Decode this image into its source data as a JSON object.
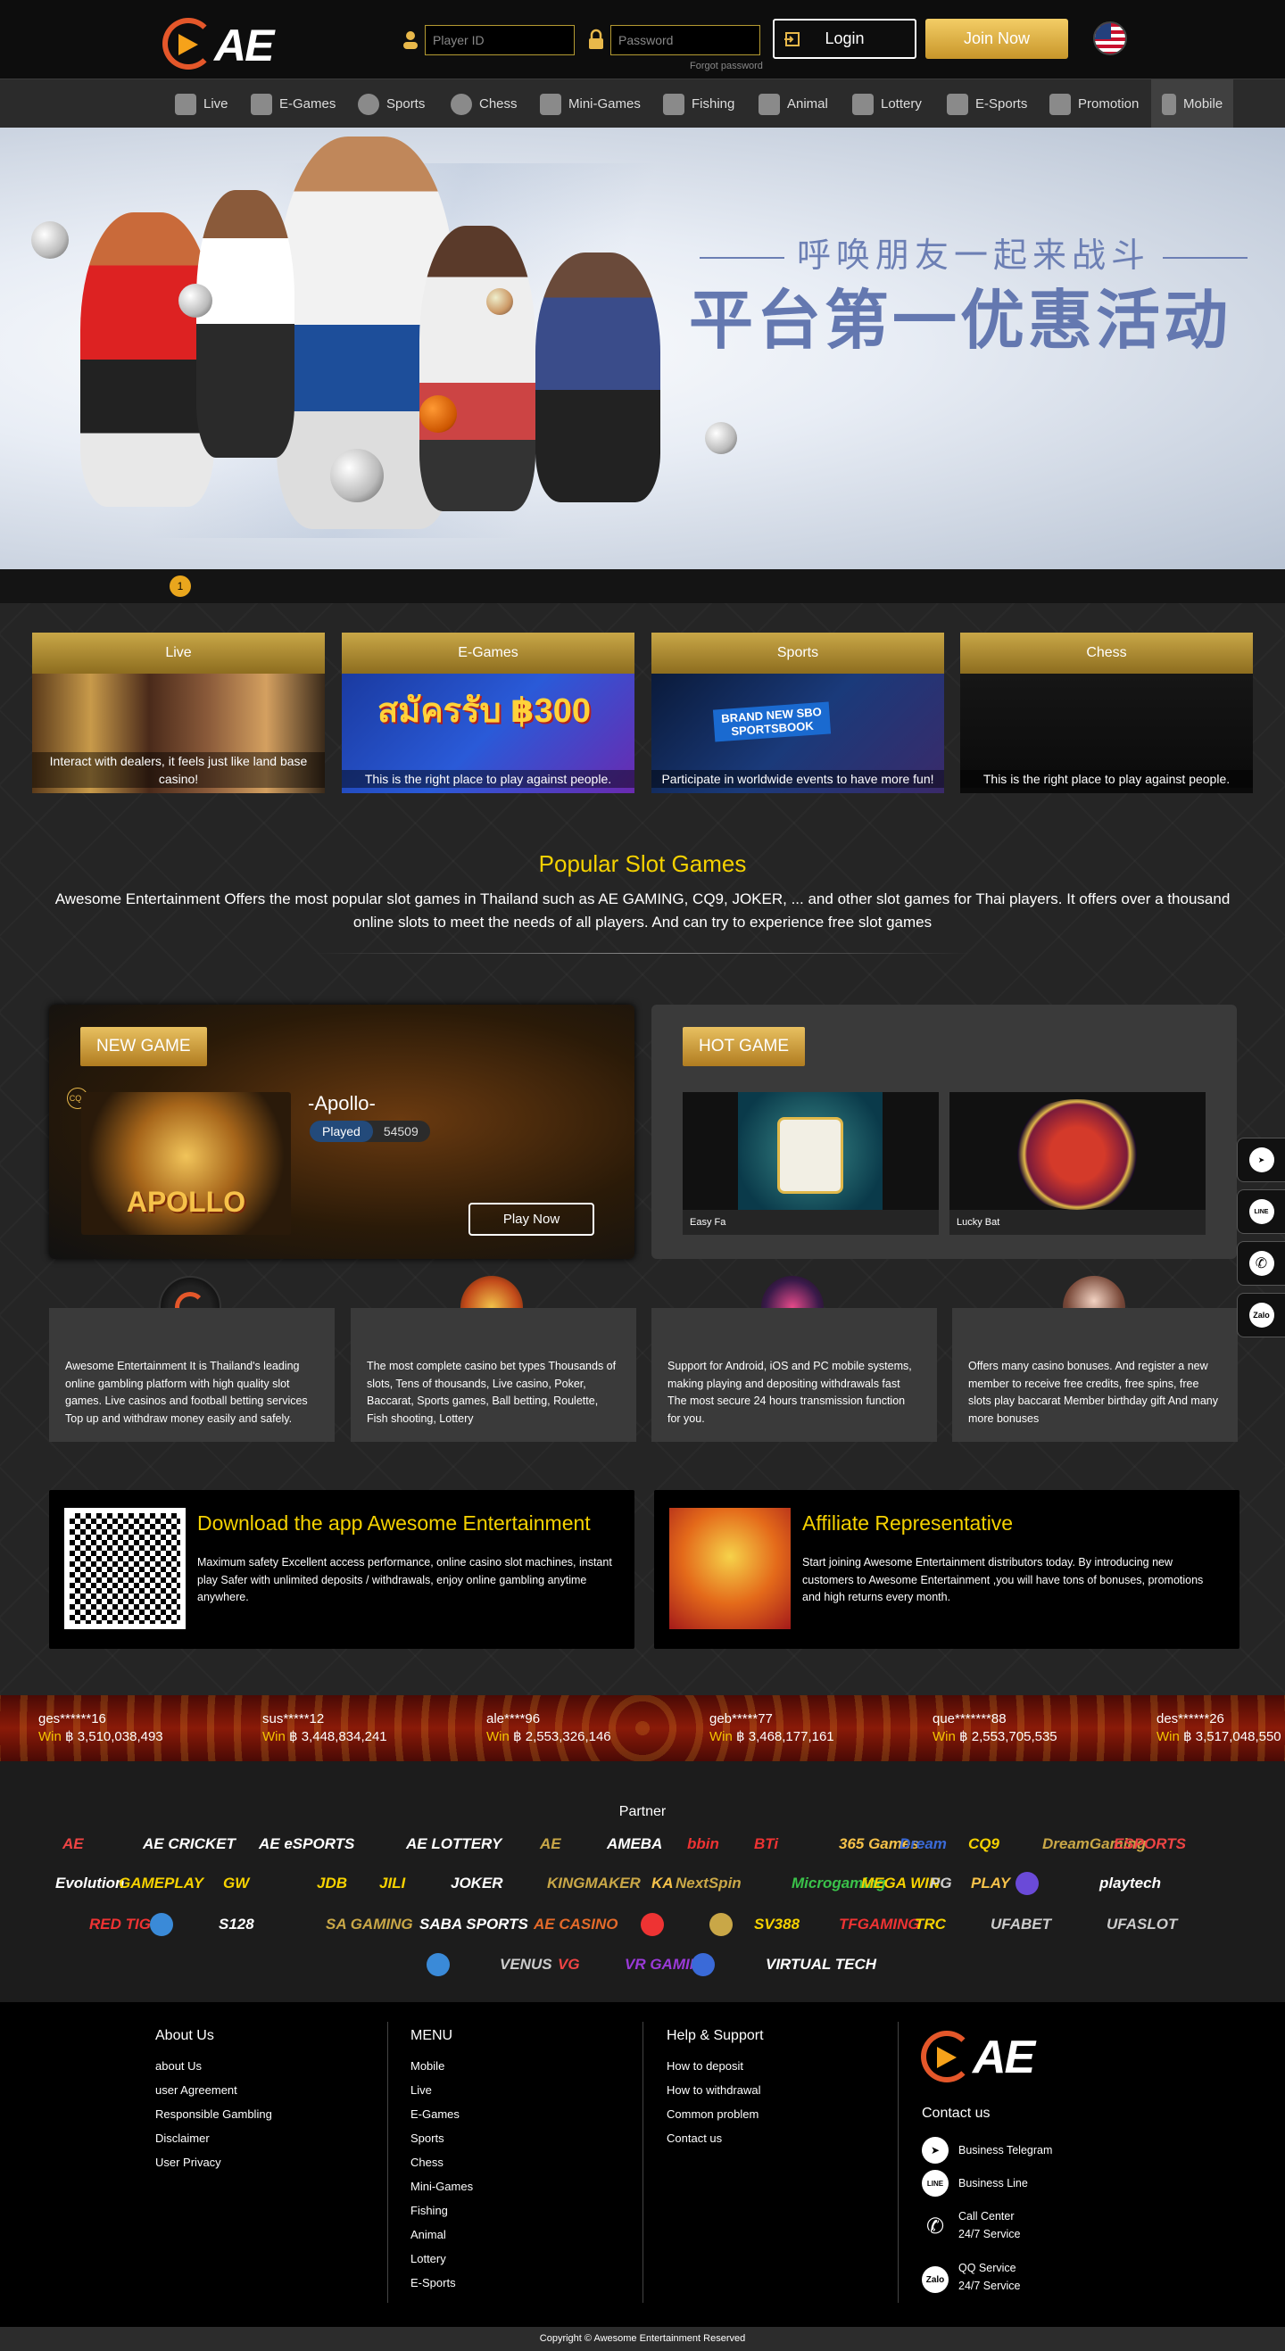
{
  "header": {
    "logo_text": "AE",
    "player_id_placeholder": "Player ID",
    "password_placeholder": "Password",
    "forgot_password": "Forgot password",
    "login_label": "Login",
    "join_label": "Join Now",
    "language_flag": "us-flag-icon"
  },
  "nav": {
    "items": [
      {
        "label": "Live",
        "icon": "live-icon"
      },
      {
        "label": "E-Games",
        "icon": "slot-icon"
      },
      {
        "label": "Sports",
        "icon": "football-icon"
      },
      {
        "label": "Chess",
        "icon": "chip-icon"
      },
      {
        "label": "Mini-Games",
        "icon": "crown-icon"
      },
      {
        "label": "Fishing",
        "icon": "fish-icon"
      },
      {
        "label": "Animal",
        "icon": "crown-icon"
      },
      {
        "label": "Lottery",
        "icon": "crown-icon"
      },
      {
        "label": "E-Sports",
        "icon": "crown-icon"
      },
      {
        "label": "Promotion",
        "icon": "gift-icon"
      },
      {
        "label": "Mobile",
        "icon": "mobile-icon"
      }
    ]
  },
  "banner": {
    "line1": "呼唤朋友一起来战斗",
    "line2": "平台第一优惠活动",
    "slide_dot": "1"
  },
  "categories": [
    {
      "title": "Live",
      "desc": "Interact with dealers, it feels just like land base casino!"
    },
    {
      "title": "E-Games",
      "desc": "This is the right place to play against people.",
      "image_text": "สมัครรับ ฿300"
    },
    {
      "title": "Sports",
      "desc": "Participate in worldwide events to have more fun!",
      "image_text": "BRAND NEW SBO SPORTSBOOK"
    },
    {
      "title": "Chess",
      "desc": "This is the right place to play against people."
    }
  ],
  "popular": {
    "title": "Popular Slot Games",
    "desc": "Awesome Entertainment Offers the most popular slot games in Thailand such as AE GAMING, CQ9, JOKER, ... and other slot games for Thai players. It offers over a thousand online slots to meet the needs of all players. And can try to experience free slot games"
  },
  "new_game": {
    "badge": "NEW GAME",
    "provider": "CQ9",
    "name": "-Apollo-",
    "image_text": "APOLLO",
    "played_label": "Played",
    "played_count": "54509",
    "play_button": "Play Now"
  },
  "hot_game": {
    "badge": "HOT GAME",
    "games": [
      {
        "name": "Easy Fa"
      },
      {
        "name": "Lucky Bat"
      }
    ]
  },
  "features": [
    {
      "text": "Awesome Entertainment It is Thailand's leading online gambling platform with high quality slot games. Live casinos and football betting services Top up and withdraw money easily and safely."
    },
    {
      "text": "The most complete casino bet types Thousands of slots, Tens of thousands, Live casino, Poker, Baccarat, Sports games, Ball betting, Roulette, Fish shooting, Lottery"
    },
    {
      "text": "Support for Android, iOS and PC mobile systems, making playing and depositing withdrawals fast The most secure 24 hours transmission function for you."
    },
    {
      "text": "Offers many casino bonuses. And register a new member to receive free credits, free spins, free slots play baccarat Member birthday gift And many more bonuses"
    }
  ],
  "download": {
    "title": "Download the app Awesome Entertainment",
    "text": "Maximum safety Excellent access performance, online casino slot machines, instant play Safer with unlimited deposits / withdrawals, enjoy online gambling anytime anywhere."
  },
  "affiliate": {
    "title": "Affiliate Representative",
    "text": "Start joining Awesome Entertainment distributors today. By introducing new customers to Awesome Entertainment ,you will have tons of bonuses, promotions and high returns every month."
  },
  "winners": [
    {
      "name": "ges******16",
      "label": "Win",
      "amount": "฿ 3,510,038,493"
    },
    {
      "name": "sus*****12",
      "label": "Win",
      "amount": "฿ 3,448,834,241"
    },
    {
      "name": "ale****96",
      "label": "Win",
      "amount": "฿ 2,553,326,146"
    },
    {
      "name": "geb*****77",
      "label": "Win",
      "amount": "฿ 3,468,177,161"
    },
    {
      "name": "que*******88",
      "label": "Win",
      "amount": "฿ 2,553,705,535"
    },
    {
      "name": "des******26",
      "label": "Win",
      "amount": "฿ 3,517,048,550"
    }
  ],
  "partner": {
    "title": "Partner",
    "logos": [
      "AE",
      "AE CRICKET",
      "AE eSPORTS",
      "AE LOTTERY",
      "AE",
      "AMEBA",
      "bbin",
      "BTi",
      "365 Games",
      "Dream",
      "CQ9",
      "DreamGaming",
      "ESPORTS",
      "Evolution",
      "GAMEPLAY",
      "GW",
      "JDB",
      "JILI",
      "JOKER",
      "KINGMAKER",
      "KA",
      "NextSpin",
      "Microgaming",
      "MEGA WIN",
      "PG",
      "PLAY",
      "",
      "playtech",
      "RED TIGER",
      "",
      "S128",
      "SA GAMING",
      "SABA SPORTS",
      "AE CASINO",
      "",
      "",
      "SV388",
      "TFGAMING",
      "TRC",
      "UFABET",
      "UFASLOT",
      "",
      "VENUS",
      "VG",
      "VR GAMING",
      "",
      "VIRTUAL TECH"
    ]
  },
  "footer": {
    "about_title": "About Us",
    "about_links": [
      "about Us",
      "user Agreement",
      "Responsible Gambling",
      "Disclaimer",
      "User Privacy"
    ],
    "menu_title": "MENU",
    "menu_links": [
      "Mobile",
      "Live",
      "E-Games",
      "Sports",
      "Chess",
      "Mini-Games",
      "Fishing",
      "Animal",
      "Lottery",
      "E-Sports"
    ],
    "help_title": "Help & Support",
    "help_links": [
      "How to deposit",
      "How to withdrawal",
      "Common problem",
      "Contact us"
    ],
    "contact_title": "Contact us",
    "contacts": [
      {
        "icon": "telegram-icon",
        "line1": "Business Telegram",
        "line2": ""
      },
      {
        "icon": "line-icon",
        "line1": "Business Line",
        "line2": ""
      },
      {
        "icon": "phone-icon",
        "line1": "Call Center",
        "line2": "24/7 Service"
      },
      {
        "icon": "zalo-icon",
        "line1": "QQ Service",
        "line2": "24/7 Service"
      }
    ],
    "copyright": "Copyright © Awesome Entertainment Reserved"
  },
  "side_contacts": [
    "telegram-icon",
    "line-icon",
    "phone-icon",
    "zalo-icon"
  ],
  "colors": {
    "accent_gold": "#c9a747",
    "title_yellow": "#f5d200",
    "brand_orange": "#e4572a"
  }
}
